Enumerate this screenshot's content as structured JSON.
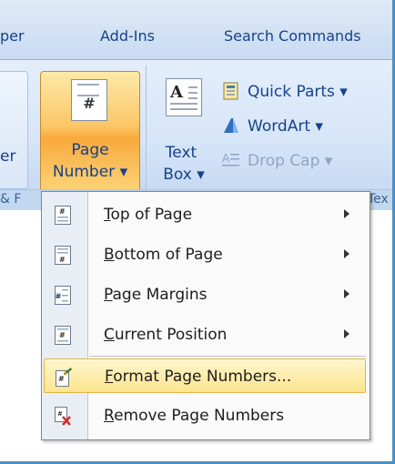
{
  "tabs": [
    "per",
    "Add-Ins",
    "Search Commands"
  ],
  "ribbon": {
    "partial_label": "er",
    "page_number": {
      "line1": "Page",
      "line2": "Number ▾",
      "icon_glyph": "#"
    },
    "text_box": {
      "line1": "Text",
      "line2": "Box ▾",
      "icon_glyph": "A"
    },
    "quick_parts": "Quick Parts ▾",
    "wordart": "WordArt ▾",
    "drop_cap": "Drop Cap ▾",
    "group_label_left": "& F",
    "group_label_right": "Tex"
  },
  "menu": {
    "items": [
      {
        "label": "Top of Page",
        "mnemonic": "T",
        "rest": "op of Page",
        "submenu": true,
        "icon": "page-top-icon"
      },
      {
        "label": "Bottom of Page",
        "mnemonic": "B",
        "rest": "ottom of Page",
        "submenu": true,
        "icon": "page-bottom-icon"
      },
      {
        "label": "Page Margins",
        "mnemonic": "P",
        "rest": "age Margins",
        "submenu": true,
        "icon": "page-margins-icon"
      },
      {
        "label": "Current Position",
        "mnemonic": "C",
        "rest": "urrent Position",
        "submenu": true,
        "icon": "current-position-icon"
      },
      {
        "label": "Format Page Numbers...",
        "mnemonic": "F",
        "rest": "ormat Page Numbers...",
        "submenu": false,
        "icon": "format-page-numbers-icon",
        "highlighted": true
      },
      {
        "label": "Remove Page Numbers",
        "mnemonic": "R",
        "rest": "emove Page Numbers",
        "submenu": false,
        "icon": "remove-page-numbers-icon"
      }
    ]
  },
  "colors": {
    "ribbon_text": "#15428b",
    "highlight_top": "#fff6cf",
    "highlight_bottom": "#fde48d",
    "button_active": "#f9a93c",
    "remove_x": "#d32f2f"
  }
}
